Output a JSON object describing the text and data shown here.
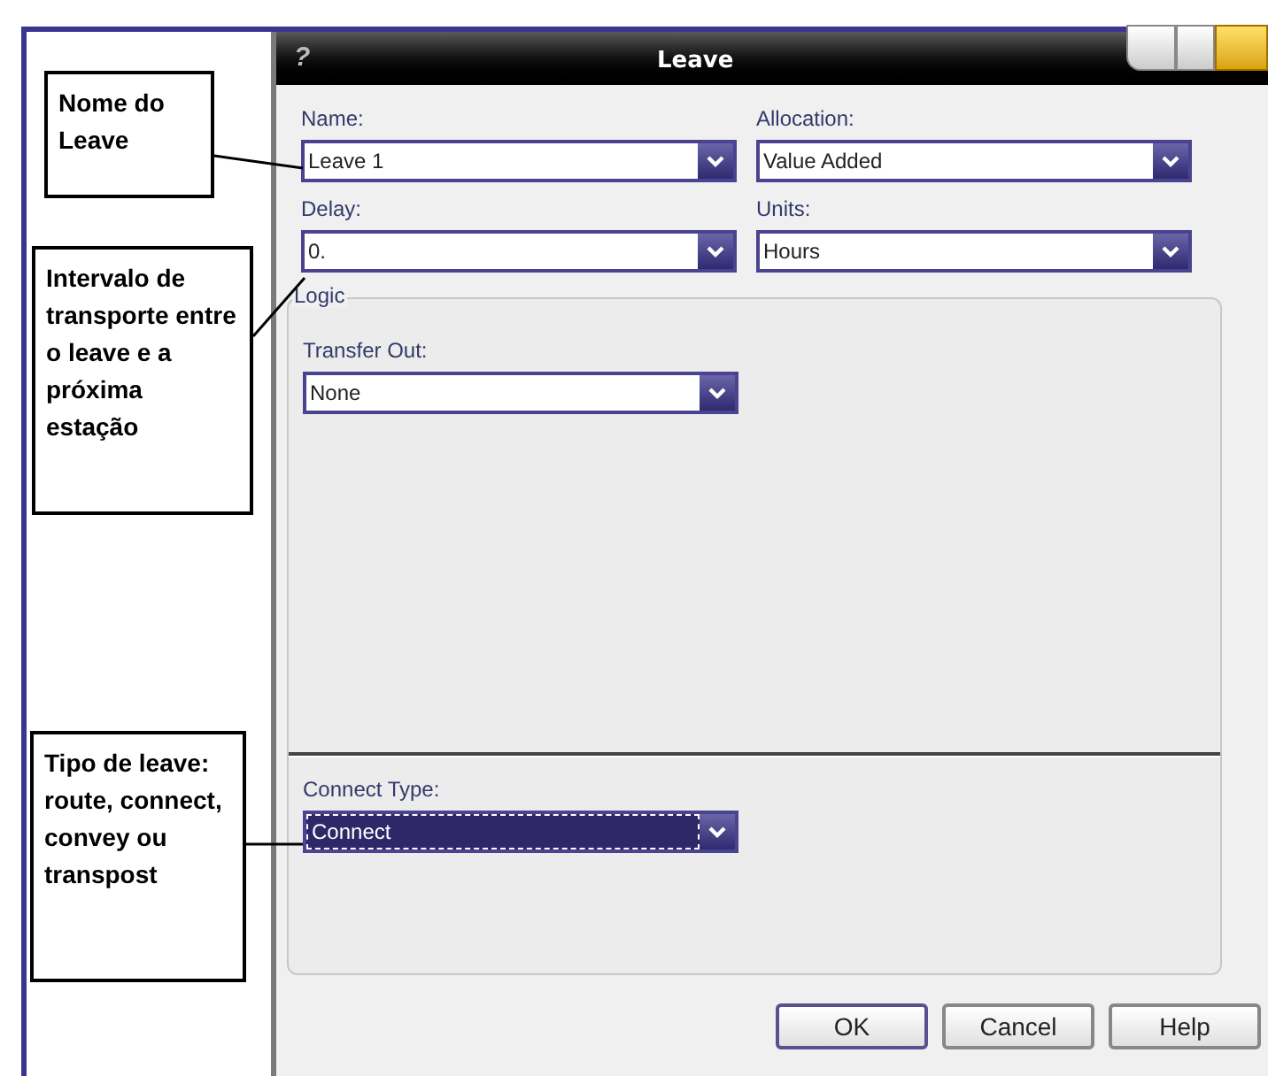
{
  "dialog": {
    "title": "Leave",
    "help_glyph": "?"
  },
  "fields": [
    {
      "label": "Name:",
      "value": "Leave 1",
      "selected": false
    },
    {
      "label": "Allocation:",
      "value": "Value Added",
      "selected": false
    },
    {
      "label": "Delay:",
      "value": "0.",
      "selected": false
    },
    {
      "label": "Units:",
      "value": "Hours",
      "selected": false
    }
  ],
  "logic": {
    "title": "Logic",
    "fields": [
      {
        "label": "Transfer Out:",
        "value": "None",
        "selected": false
      }
    ]
  },
  "connect": {
    "fields": [
      {
        "label": "Connect Type:",
        "value": "Connect",
        "selected": true
      }
    ]
  },
  "buttons": [
    {
      "label": "OK",
      "default": true
    },
    {
      "label": "Cancel",
      "default": false
    },
    {
      "label": "Help",
      "default": false
    }
  ],
  "callouts": [
    {
      "text": "Nome do Leave"
    },
    {
      "text": "Intervalo de transporte entre o leave e a próxima estação"
    },
    {
      "text": "Tipo de leave: route, connect, convey ou transpost"
    }
  ]
}
